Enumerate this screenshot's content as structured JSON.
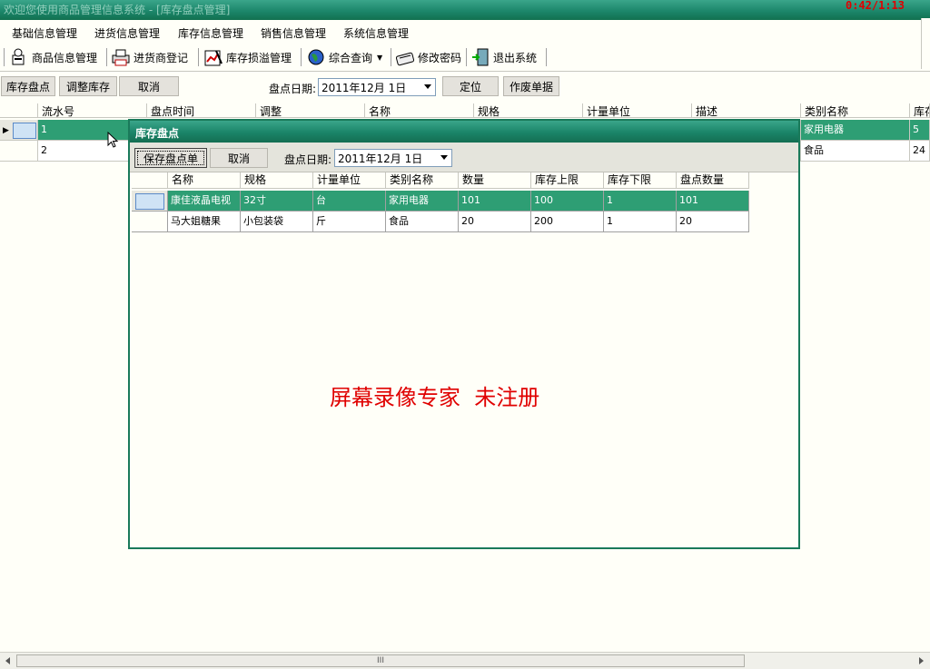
{
  "window": {
    "title": "欢迎您使用商品管理信息系统 - [库存盘点管理]",
    "timer": "0:42/1:13"
  },
  "menu": {
    "items": [
      {
        "label": "基础信息管理"
      },
      {
        "label": "进货信息管理"
      },
      {
        "label": "库存信息管理"
      },
      {
        "label": "销售信息管理"
      },
      {
        "label": "系统信息管理"
      }
    ]
  },
  "toolbar": {
    "items": [
      {
        "label": "商品信息管理",
        "icon": "user-stack-icon"
      },
      {
        "label": "进货商登记",
        "icon": "printer-icon"
      },
      {
        "label": "库存损溢管理",
        "icon": "chart-pen-icon"
      },
      {
        "label": "综合查询",
        "icon": "globe-icon"
      },
      {
        "label": "修改密码",
        "icon": "keyboard-icon"
      },
      {
        "label": "退出系统",
        "icon": "exit-door-icon"
      }
    ]
  },
  "actionbar": {
    "inventory_check": "库存盘点",
    "adjust_stock": "调整库存",
    "cancel": "取消",
    "date_label": "盘点日期:",
    "date_value": "2011年12月  1日",
    "locate": "定位",
    "void": "作废单据"
  },
  "grid": {
    "columns": [
      "流水号",
      "盘点时间",
      "调整",
      "名称",
      "规格",
      "计量单位",
      "描述",
      "类别名称",
      "库存"
    ],
    "rows": [
      {
        "serial": "1",
        "category": "家用电器",
        "stock": "5"
      },
      {
        "serial": "2",
        "category": "食品",
        "stock": "24"
      }
    ]
  },
  "dialog": {
    "title": "库存盘点",
    "save": "保存盘点单",
    "cancel": "取消",
    "date_label": "盘点日期:",
    "date_value": "2011年12月  1日",
    "columns": [
      "名称",
      "规格",
      "计量单位",
      "类别名称",
      "数量",
      "库存上限",
      "库存下限",
      "盘点数量"
    ],
    "rows": [
      [
        "康佳液晶电视",
        "32寸",
        "台",
        "家用电器",
        "101",
        "100",
        "1",
        "101"
      ],
      [
        "马大姐糖果",
        "小包装袋",
        "斤",
        "食品",
        "20",
        "200",
        "1",
        "20"
      ]
    ],
    "watermark": "屏幕录像专家  未注册"
  },
  "scrollbar": {
    "thumb_grip": "III"
  },
  "colors": {
    "accent": "#1a8468",
    "selection": "#2e9e74",
    "watermark": "#e00000",
    "timer": "#e00000"
  }
}
